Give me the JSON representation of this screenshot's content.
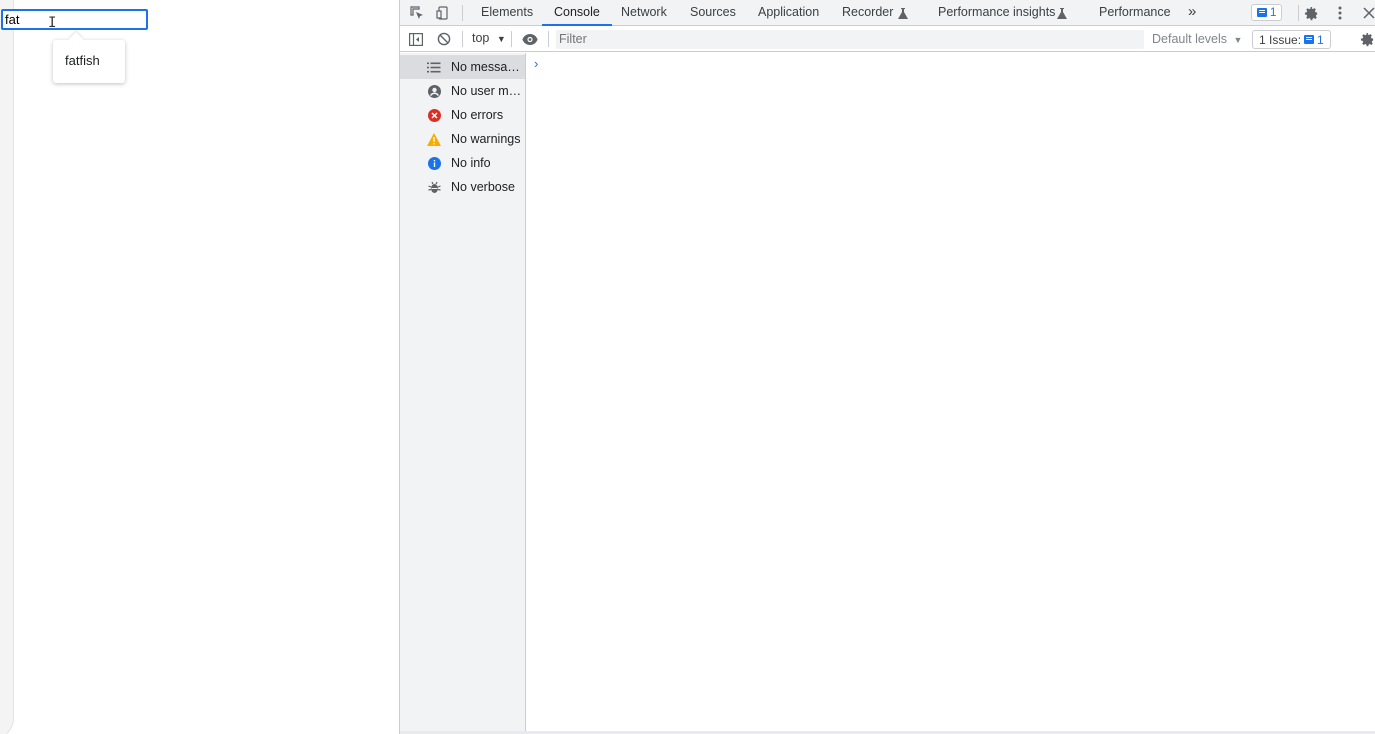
{
  "page": {
    "search_value": "fat",
    "suggestion": "fatfish"
  },
  "devtools": {
    "tabs": [
      {
        "label": "Elements"
      },
      {
        "label": "Console"
      },
      {
        "label": "Network"
      },
      {
        "label": "Sources"
      },
      {
        "label": "Application"
      },
      {
        "label": "Recorder",
        "flask": "flask-icon"
      },
      {
        "label": "Performance insights",
        "flask": "flask-icon"
      },
      {
        "label": "Performance"
      }
    ],
    "active_tab": "Console",
    "more_tabs_glyph": "»",
    "messages_badge": "1",
    "toolbar": {
      "context": "top",
      "filter_placeholder": "Filter",
      "levels": "Default levels",
      "issues_label": "1 Issue:",
      "issues_count": "1"
    },
    "sidebar": [
      {
        "label": "No messages",
        "icon": "list-icon",
        "color": "#5f6368"
      },
      {
        "label": "No user me…",
        "icon": "user-icon",
        "color": "#5f6368"
      },
      {
        "label": "No errors",
        "icon": "error-icon",
        "color": "#d93025"
      },
      {
        "label": "No warnings",
        "icon": "warning-icon",
        "color": "#f9ab00"
      },
      {
        "label": "No info",
        "icon": "info-icon",
        "color": "#1a73e8"
      },
      {
        "label": "No verbose",
        "icon": "bug-icon",
        "color": "#5f6368"
      }
    ],
    "prompt_glyph": "›"
  }
}
